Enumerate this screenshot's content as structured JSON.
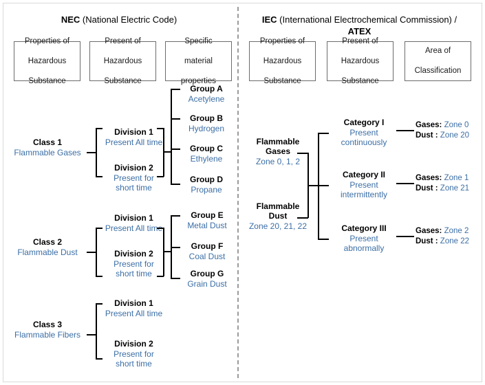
{
  "diagram": {
    "title": "Hazardous Area Classification - NEC vs IEC/ATEX",
    "accent_blue": "#3b6ea5",
    "line_color": "#000000",
    "box_border": "#6b6b6b",
    "divider_color": "#9a9a9a"
  },
  "nec": {
    "heading_bold": "NEC",
    "heading_rest": " (National Electric Code)",
    "columns": [
      {
        "name": "properties-of-hazardous-substance",
        "line1": "Properties of",
        "line2": "Hazardous",
        "line3": "Substance"
      },
      {
        "name": "present-of-hazardous-substance",
        "line1": "Present of",
        "line2": "Hazardous",
        "line3": "Substance"
      },
      {
        "name": "specific-material-properties",
        "line1": "Specific",
        "line2": "material",
        "line3": "properties"
      }
    ],
    "classes": [
      {
        "title": "Class 1",
        "subtitle": "Flammable Gases"
      },
      {
        "title": "Class 2",
        "subtitle": "Flammable Dust"
      },
      {
        "title": "Class 3",
        "subtitle": "Flammable Fibers"
      }
    ],
    "divisions": [
      {
        "title": "Division 1",
        "sub1": "Present All time",
        "sub2": ""
      },
      {
        "title": "Division 2",
        "sub1": "Present for",
        "sub2": "short time"
      },
      {
        "title": "Division 1",
        "sub1": "Present All time",
        "sub2": ""
      },
      {
        "title": "Division 2",
        "sub1": "Present for",
        "sub2": "short time"
      },
      {
        "title": "Division 1",
        "sub1": "Present All time",
        "sub2": ""
      },
      {
        "title": "Division 2",
        "sub1": "Present for",
        "sub2": "short time"
      }
    ],
    "groups": [
      {
        "title": "Group A",
        "material": "Acetylene"
      },
      {
        "title": "Group B",
        "material": "Hydrogen"
      },
      {
        "title": "Group C",
        "material": "Ethylene"
      },
      {
        "title": "Group D",
        "material": "Propane"
      },
      {
        "title": "Group E",
        "material": "Metal Dust"
      },
      {
        "title": "Group F",
        "material": "Coal Dust"
      },
      {
        "title": "Group G",
        "material": "Grain Dust"
      }
    ]
  },
  "iec": {
    "heading_bold": "IEC",
    "heading_rest": " (International Electrochemical Commission) /",
    "heading_line2": "ATEX",
    "columns": [
      {
        "name": "properties-of-hazardous-substance",
        "line1": "Properties of",
        "line2": "Hazardous",
        "line3": "Substance"
      },
      {
        "name": "present-of-hazardous-substance",
        "line1": "Present of",
        "line2": "Hazardous",
        "line3": "Substance"
      },
      {
        "name": "area-of-classification",
        "line1": "Area of",
        "line2": "Classification",
        "line3": ""
      }
    ],
    "substances": [
      {
        "title1": "Flammable",
        "title2": "Gases",
        "zones": "Zone 0, 1, 2"
      },
      {
        "title1": "Flammable",
        "title2": "Dust",
        "zones": "Zone 20, 21, 22"
      }
    ],
    "categories": [
      {
        "title": "Category I",
        "sub1": "Present",
        "sub2": "continuously"
      },
      {
        "title": "Category II",
        "sub1": "Present",
        "sub2": "intermittently"
      },
      {
        "title": "Category III",
        "sub1": "Present",
        "sub2": "abnormally"
      }
    ],
    "zones": [
      {
        "gases_key": "Gases:",
        "gases_value": "Zone 0",
        "dust_key": "Dust  :",
        "dust_value": "Zone 20"
      },
      {
        "gases_key": "Gases:",
        "gases_value": "Zone 1",
        "dust_key": "Dust  :",
        "dust_value": "Zone 21"
      },
      {
        "gases_key": "Gases:",
        "gases_value": "Zone 2",
        "dust_key": "Dust  :",
        "dust_value": "Zone 22"
      }
    ]
  }
}
